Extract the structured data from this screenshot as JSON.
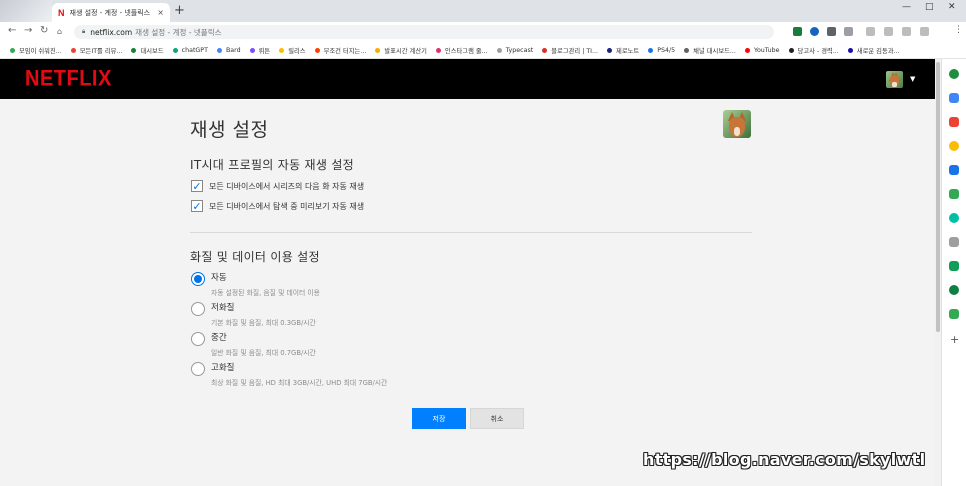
{
  "browser": {
    "tab_title": "재생 설정 - 계정 - 넷플릭스",
    "tab_logo": "N",
    "new_tab": "+",
    "close_tab": "×",
    "window_controls": [
      "—",
      "□",
      "✕"
    ],
    "url_domain": "netflix.com",
    "url_path": "재생 설정 - 계정 - 넷플릭스",
    "bookmarks": [
      {
        "label": "모임이 쉬워진...",
        "color": "#34a853"
      },
      {
        "label": "모든IT를 리뷰...",
        "color": "#ea4335"
      },
      {
        "label": "대시보드",
        "color": "#188038"
      },
      {
        "label": "chatGPT",
        "color": "#10a37f"
      },
      {
        "label": "Bard",
        "color": "#4285f4"
      },
      {
        "label": "뤼튼",
        "color": "#7c4dff"
      },
      {
        "label": "릴리스",
        "color": "#fbbc04"
      },
      {
        "label": "무조건 터지는...",
        "color": "#ff3d00"
      },
      {
        "label": "발표시간 계산기",
        "color": "#f9ab00"
      },
      {
        "label": "인스타그램 줄...",
        "color": "#e1306c"
      },
      {
        "label": "Typecast",
        "color": "#9aa0a6"
      },
      {
        "label": "블로그관리 | TI...",
        "color": "#d93025"
      },
      {
        "label": "제로노트",
        "color": "#1a237e"
      },
      {
        "label": "PS4/5",
        "color": "#1a73e8"
      },
      {
        "label": "채널 대시보드...",
        "color": "#5f6368"
      },
      {
        "label": "YouTube",
        "color": "#ff0000"
      },
      {
        "label": "당고사 - 경력...",
        "color": "#202124"
      },
      {
        "label": "새로운 김동과...",
        "color": "#1a0dab"
      }
    ],
    "side_icon_colors": [
      "#1e8e3e",
      "#4285f4",
      "#ea4335",
      "#fbbc04",
      "#1a73e8",
      "#34a853",
      "#00bfa5",
      "#9e9e9e",
      "#0f9d58",
      "#0b8043",
      "#34a853"
    ],
    "add_icon": "+"
  },
  "netflix": {
    "logo": "NETFLIX",
    "brand_color": "#e50914",
    "accent_color": "#0080ff",
    "page_title": "재생 설정",
    "autoplay_section_title": "IT시대 프로필의 자동 재생 설정",
    "autoplay_options": [
      {
        "label": "모든 디바이스에서 시리즈의 다음 화 자동 재생",
        "checked": true
      },
      {
        "label": "모든 디바이스에서 탐색 중 미리보기 자동 재생",
        "checked": true
      }
    ],
    "quality_section_title": "화질 및 데이터 이용 설정",
    "quality_options": [
      {
        "label": "자동",
        "desc": "자동 설정된 화질, 음질 및 데이터 이용",
        "selected": true
      },
      {
        "label": "저화질",
        "desc": "기본 화질 및 음질, 최대 0.3GB/시간",
        "selected": false
      },
      {
        "label": "중간",
        "desc": "일반 화질 및 음질, 최대 0.7GB/시간",
        "selected": false
      },
      {
        "label": "고화질",
        "desc": "최상 화질 및 음질, HD 최대 3GB/시간, UHD 최대 7GB/시간",
        "selected": false
      }
    ],
    "save_label": "저장",
    "cancel_label": "취소"
  },
  "watermark": "https://blog.naver.com/skylwtl"
}
